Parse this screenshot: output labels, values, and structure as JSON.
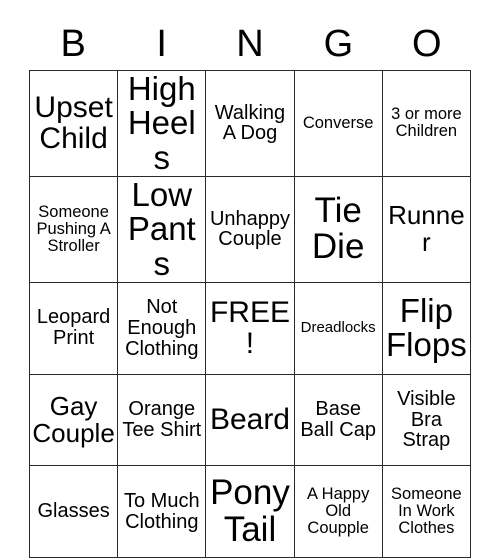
{
  "card": {
    "header_letters": [
      "B",
      "I",
      "N",
      "G",
      "O"
    ],
    "rows": [
      [
        {
          "text": "Upset Child",
          "size": "fs-l"
        },
        {
          "text": "High Heels",
          "size": "fs-xl"
        },
        {
          "text": "Walking A Dog",
          "size": "fs-s"
        },
        {
          "text": "Converse",
          "size": "fs-xs"
        },
        {
          "text": "3 or more Children",
          "size": "fs-xs"
        }
      ],
      [
        {
          "text": "Someone Pushing A Stroller",
          "size": "fs-xs"
        },
        {
          "text": "Low Pants",
          "size": "fs-xl"
        },
        {
          "text": "Unhappy Couple",
          "size": "fs-s"
        },
        {
          "text": "Tie Die",
          "size": "fs-xxl"
        },
        {
          "text": "Runner",
          "size": "fs-m"
        }
      ],
      [
        {
          "text": "Leopard Print",
          "size": "fs-s"
        },
        {
          "text": "Not Enough Clothing",
          "size": "fs-s"
        },
        {
          "text": "FREE!",
          "size": "fs-l"
        },
        {
          "text": "Dreadlocks",
          "size": "fs-xxs"
        },
        {
          "text": "Flip Flops",
          "size": "fs-xl"
        }
      ],
      [
        {
          "text": "Gay Couple",
          "size": "fs-m"
        },
        {
          "text": "Orange Tee Shirt",
          "size": "fs-s"
        },
        {
          "text": "Beard",
          "size": "fs-l"
        },
        {
          "text": "Base Ball Cap",
          "size": "fs-s"
        },
        {
          "text": "Visible Bra Strap",
          "size": "fs-s"
        }
      ],
      [
        {
          "text": "Glasses",
          "size": "fs-s"
        },
        {
          "text": "To Much Clothing",
          "size": "fs-s"
        },
        {
          "text": "Pony Tail",
          "size": "fs-xxl"
        },
        {
          "text": "A Happy Old Coupple",
          "size": "fs-xs"
        },
        {
          "text": "Someone In Work Clothes",
          "size": "fs-xs"
        }
      ]
    ]
  },
  "colors": {
    "background": "#ffffff",
    "text": "#000000",
    "grid_line": "#2a2a2a"
  }
}
